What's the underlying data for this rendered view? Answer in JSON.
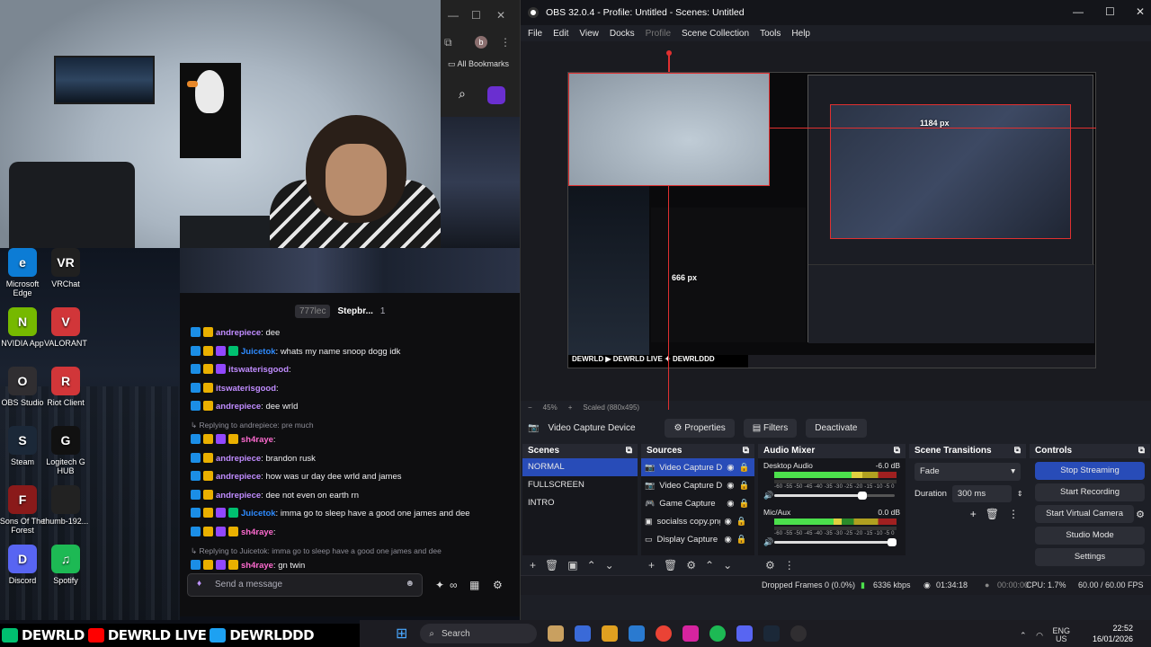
{
  "desktop": {
    "icons": [
      {
        "label": "Microsoft Edge",
        "color": "#0c7cd5",
        "glyph": "e"
      },
      {
        "label": "VRChat",
        "color": "#202020",
        "glyph": "VR"
      },
      {
        "label": "NVIDIA App",
        "color": "#76b900",
        "glyph": "N"
      },
      {
        "label": "VALORANT",
        "color": "#d13639",
        "glyph": "V"
      },
      {
        "label": "OBS Studio",
        "color": "#302e31",
        "glyph": "O"
      },
      {
        "label": "Riot Client",
        "color": "#d13639",
        "glyph": "R"
      },
      {
        "label": "Steam",
        "color": "#1b2838",
        "glyph": "S"
      },
      {
        "label": "Logitech G HUB",
        "color": "#111111",
        "glyph": "G"
      },
      {
        "label": "Sons Of The Forest",
        "color": "#8a1a1a",
        "glyph": "F"
      },
      {
        "label": "thumb-192...",
        "color": "#222222",
        "glyph": ""
      },
      {
        "label": "Discord",
        "color": "#5865f2",
        "glyph": "D"
      },
      {
        "label": "Spotify",
        "color": "#1db954",
        "glyph": "♫"
      }
    ]
  },
  "browser": {
    "bookmarks": "All Bookmarks",
    "profile": "b"
  },
  "chat": {
    "header_badge": "777lec",
    "header_user": "Stepbr...",
    "header_count": "1",
    "messages": [
      {
        "user": "andrepiece",
        "color": "#c08cff",
        "text": ": dee",
        "badges": [
          "blue",
          "gold"
        ]
      },
      {
        "user": "Juicetok",
        "color": "#2e8bff",
        "text": ": whats my name snoop dogg idk",
        "badges": [
          "blue",
          "gold",
          "purple",
          "green"
        ]
      },
      {
        "user": "itswaterisgood",
        "color": "#c08cff",
        "text": ":",
        "badges": [
          "blue",
          "gold",
          "purple"
        ]
      },
      {
        "user": "itswaterisgood",
        "color": "#c08cff",
        "text": ":",
        "badges": [
          "blue",
          "gold"
        ]
      },
      {
        "user": "andrepiece",
        "color": "#c08cff",
        "text": ": dee wrld",
        "badges": [
          "blue",
          "gold"
        ]
      },
      {
        "reply": "Replying to andrepiece: pre much"
      },
      {
        "user": "sh4raye",
        "color": "#ff6bd0",
        "text": ":",
        "badges": [
          "blue",
          "gold",
          "purple",
          "gold"
        ]
      },
      {
        "user": "andrepiece",
        "color": "#c08cff",
        "text": ": brandon rusk",
        "badges": [
          "blue",
          "gold"
        ]
      },
      {
        "user": "andrepiece",
        "color": "#c08cff",
        "text": ": how was ur day dee wrld and james",
        "badges": [
          "blue",
          "gold"
        ]
      },
      {
        "user": "andrepiece",
        "color": "#c08cff",
        "text": ": dee not even on earth rn",
        "badges": [
          "blue",
          "gold"
        ]
      },
      {
        "user": "Juicetok",
        "color": "#2e8bff",
        "text": ": imma go to sleep have a good one james and dee",
        "badges": [
          "blue",
          "gold",
          "purple",
          "green"
        ]
      },
      {
        "user": "sh4raye",
        "color": "#ff6bd0",
        "text": ":",
        "badges": [
          "blue",
          "gold",
          "purple",
          "gold"
        ]
      },
      {
        "reply": "Replying to Juicetok: imma go to sleep have a good one james and dee"
      },
      {
        "user": "sh4raye",
        "color": "#ff6bd0",
        "text": ": gn twin",
        "badges": [
          "blue",
          "gold",
          "purple",
          "gold"
        ]
      }
    ],
    "input_placeholder": "Send a message"
  },
  "banner": {
    "items": [
      "DEWRLD",
      "DEWRLD LIVE",
      "DEWRLDDD"
    ]
  },
  "taskbar": {
    "search": "Search",
    "lang": "ENG",
    "region": "US",
    "time": "22:52",
    "date": "16/01/2026"
  },
  "obs": {
    "title": "OBS 32.0.4 - Profile: Untitled - Scenes: Untitled",
    "menu": [
      "File",
      "Edit",
      "View",
      "Docks",
      "Profile",
      "Scene Collection",
      "Tools",
      "Help"
    ],
    "preview": {
      "width_label": "1184 px",
      "height_label": "666 px",
      "zoom": "45%",
      "scale": "Scaled (880x495)"
    },
    "source_toolbar": {
      "selected_source": "Video Capture Device",
      "properties": "Properties",
      "filters": "Filters",
      "deactivate": "Deactivate"
    },
    "scenes": {
      "title": "Scenes",
      "items": [
        "NORMAL",
        "FULLSCREEN",
        "INTRO"
      ],
      "active_index": 0
    },
    "sources": {
      "title": "Sources",
      "items": [
        "Video Capture De",
        "Video Capture De",
        "Game Capture",
        "socialss copy.png",
        "Display Capture"
      ]
    },
    "mixer": {
      "title": "Audio Mixer",
      "channels": [
        {
          "name": "Desktop Audio",
          "db": "-6.0 dB",
          "level": 0.72,
          "volume": 0.75
        },
        {
          "name": "Mic/Aux",
          "db": "0.0 dB",
          "level": 0.55,
          "volume": 1.0
        }
      ],
      "ticks": "-60 -55 -50 -45 -40 -35 -30 -25 -20 -15 -10 -5 0"
    },
    "transitions": {
      "title": "Scene Transitions",
      "type": "Fade",
      "duration_label": "Duration",
      "duration": "300 ms"
    },
    "controls": {
      "title": "Controls",
      "buttons": [
        "Stop Streaming",
        "Start Recording",
        "Start Virtual Camera",
        "Studio Mode",
        "Settings"
      ]
    },
    "status": {
      "dropped": "Dropped Frames 0 (0.0%)",
      "bitrate": "6336 kbps",
      "stream_time": "01:34:18",
      "rec_time": "00:00:00",
      "cpu": "CPU: 1.7%",
      "fps": "60.00 / 60.00 FPS"
    }
  }
}
